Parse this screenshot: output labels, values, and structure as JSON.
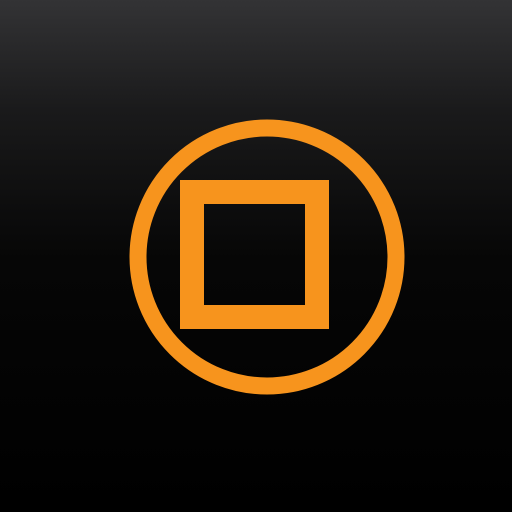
{
  "icon": {
    "name": "stop-button-icon",
    "colors": {
      "accent": "#F7941D",
      "background_top": "#333335",
      "background_bottom": "#000000"
    }
  }
}
